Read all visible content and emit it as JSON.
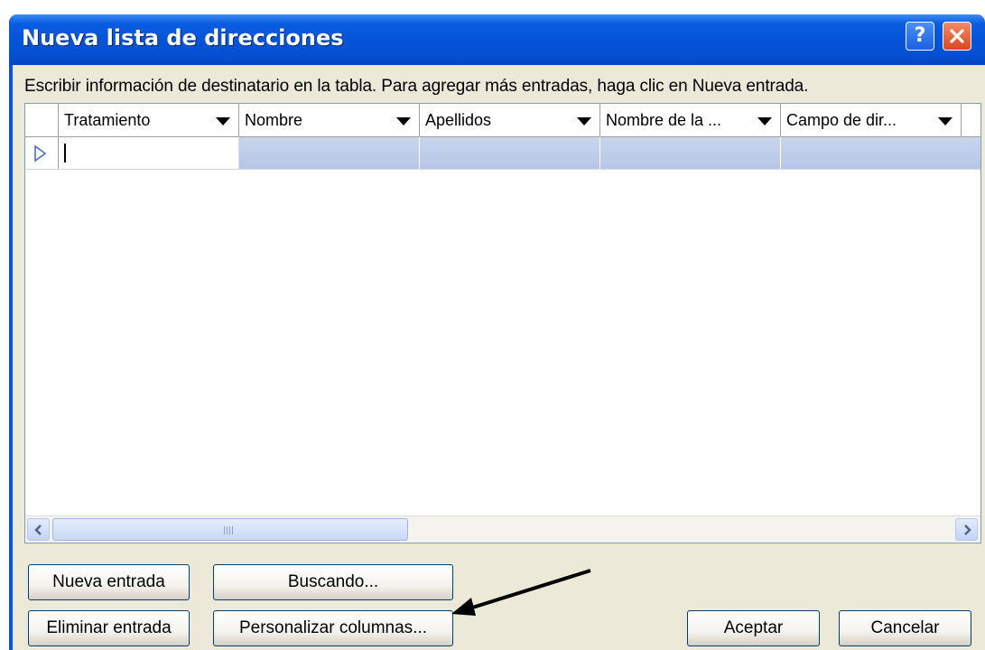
{
  "window": {
    "title": "Nueva lista de direcciones",
    "help_glyph": "?",
    "title_gradient_color": "#0554d8"
  },
  "instruction": "Escribir información de destinatario en la tabla. Para agregar más entradas, haga clic en Nueva entrada.",
  "grid": {
    "columns": [
      {
        "label": "Tratamiento"
      },
      {
        "label": "Nombre"
      },
      {
        "label": "Apellidos"
      },
      {
        "label": "Nombre de la ..."
      },
      {
        "label": "Campo de dir..."
      }
    ],
    "row_selected_color": "#c0d0ec",
    "current_row_icon": "current-row-triangle-icon"
  },
  "buttons": {
    "new_entry": "Nueva entrada",
    "find": "Buscando...",
    "delete_entry": "Eliminar entrada",
    "customize_columns": "Personalizar columnas...",
    "ok": "Aceptar",
    "cancel": "Cancelar"
  },
  "annotation": {
    "pointer": "arrow-pointer-icon"
  }
}
